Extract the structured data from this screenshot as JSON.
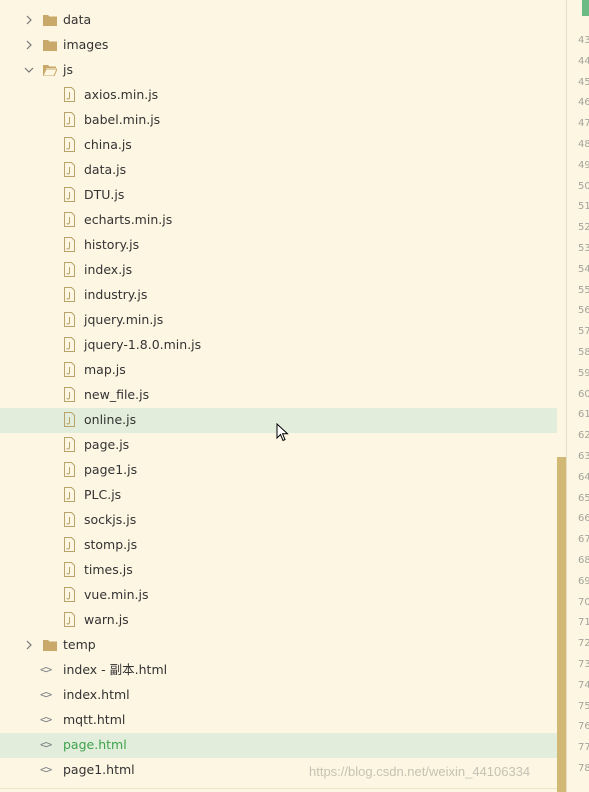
{
  "tree": {
    "folders": {
      "data": "data",
      "images": "images",
      "js": "js",
      "temp": "temp"
    },
    "js_files": [
      "axios.min.js",
      "babel.min.js",
      "china.js",
      "data.js",
      "DTU.js",
      "echarts.min.js",
      "history.js",
      "index.js",
      "industry.js",
      "jquery.min.js",
      "jquery-1.8.0.min.js",
      "map.js",
      "new_file.js",
      "online.js",
      "page.js",
      "page1.js",
      "PLC.js",
      "sockjs.js",
      "stomp.js",
      "times.js",
      "vue.min.js",
      "warn.js"
    ],
    "html_files": [
      "index - 副本.html",
      "index.html",
      "mqtt.html",
      "page.html",
      "page1.html"
    ],
    "hovered_file": "online.js",
    "active_file": "page.html"
  },
  "gutter": {
    "line_numbers": [
      "43",
      "44",
      "45",
      "46",
      "47",
      "48",
      "49",
      "50",
      "51",
      "52",
      "53",
      "54",
      "55",
      "56",
      "57",
      "58",
      "59",
      "60",
      "61",
      "62",
      "63",
      "64",
      "65",
      "66",
      "67",
      "68",
      "69",
      "70",
      "71",
      "72",
      "73",
      "74",
      "75",
      "76",
      "77",
      "78"
    ]
  },
  "watermark": "https://blog.csdn.net/weixin_44106334",
  "colors": {
    "background": "#fdf6e3",
    "selection": "#e2eedb",
    "active_text": "#3ea34e",
    "folder_icon": "#c8a96a",
    "scroll_thumb": "#d1b875"
  }
}
